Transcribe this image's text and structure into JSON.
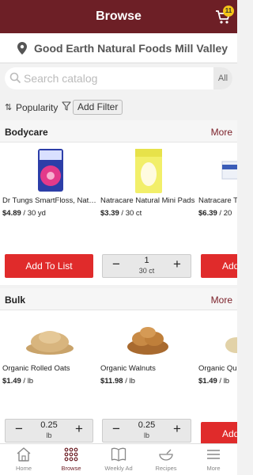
{
  "header": {
    "title": "Browse",
    "cart_count": "11"
  },
  "store": {
    "name": "Good Earth Natural Foods Mill Valley"
  },
  "search": {
    "placeholder": "Search catalog",
    "scope": "All"
  },
  "sort": {
    "label": "Popularity",
    "filter_label": "Add Filter"
  },
  "sections": [
    {
      "title": "Bodycare",
      "more": "More",
      "products": [
        {
          "name": "Dr Tungs SmartFloss, Natural",
          "price": "$4.89",
          "unit": "/ 30 yd"
        },
        {
          "name": "Natracare Natural Mini Pads",
          "price": "$3.39",
          "unit": "/ 30 ct"
        },
        {
          "name": "Natracare Tampons",
          "price": "$6.39",
          "unit": "/ 20"
        }
      ],
      "actions": {
        "add_label": "Add To List",
        "stepper_qty": "1",
        "stepper_unit": "30 ct",
        "add_short": "Add"
      }
    },
    {
      "title": "Bulk",
      "more": "More",
      "products": [
        {
          "name": "Organic Rolled Oats",
          "price": "$1.49",
          "unit": "/ lb"
        },
        {
          "name": "Organic Walnuts",
          "price": "$11.98",
          "unit": "/ lb"
        },
        {
          "name": "Organic Quinoa",
          "price": "$1.49",
          "unit": "/ lb"
        }
      ],
      "actions": {
        "stepper1_qty": "0.25",
        "stepper1_unit": "lb",
        "stepper2_qty": "0.25",
        "stepper2_unit": "lb",
        "add_short": "Add"
      }
    }
  ],
  "tabs": [
    {
      "label": "Home",
      "icon": "home-icon"
    },
    {
      "label": "Browse",
      "icon": "grid-dots-icon"
    },
    {
      "label": "Weekly Ad",
      "icon": "book-icon"
    },
    {
      "label": "Recipes",
      "icon": "bowl-icon"
    },
    {
      "label": "More",
      "icon": "hamburger-icon"
    }
  ],
  "colors": {
    "brand": "#6d1f26",
    "accent": "#e02b2b",
    "badge": "#f5c518"
  }
}
